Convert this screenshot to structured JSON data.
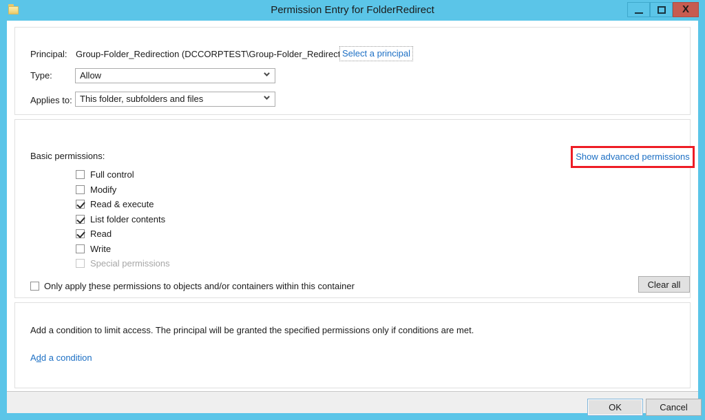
{
  "window": {
    "title": "Permission Entry for FolderRedirect",
    "icon": "folder-icon",
    "controls": {
      "minimize": "–",
      "maximize": "❑",
      "close": "X"
    }
  },
  "principal_section": {
    "principal_label": "Principal:",
    "principal_value": "Group-Folder_Redirection (DCCORPTEST\\Group-Folder_Redirection)",
    "select_principal_link": "Select a principal",
    "type_label": "Type:",
    "type_value": "Allow",
    "applies_to_label": "Applies to:",
    "applies_to_value": "This folder, subfolders and files"
  },
  "permissions_section": {
    "heading": "Basic permissions:",
    "advanced_link": "Show advanced permissions",
    "advanced_link_highlight_color": "#EE1C25",
    "items": [
      {
        "label": "Full control",
        "checked": false,
        "disabled": false
      },
      {
        "label": "Modify",
        "checked": false,
        "disabled": false
      },
      {
        "label": "Read & execute",
        "checked": true,
        "disabled": false
      },
      {
        "label": "List folder contents",
        "checked": true,
        "disabled": false
      },
      {
        "label": "Read",
        "checked": true,
        "disabled": false
      },
      {
        "label": "Write",
        "checked": false,
        "disabled": false
      },
      {
        "label": "Special permissions",
        "checked": false,
        "disabled": true
      }
    ],
    "only_apply": {
      "text_before": "Only apply ",
      "accesskey": "t",
      "text_after": "hese permissions to objects and/or containers within this container",
      "checked": false
    },
    "clear_all_button": "Clear all"
  },
  "condition_section": {
    "description": "Add a condition to limit access. The principal will be granted the specified permissions only if conditions are met.",
    "add_condition_link": {
      "text_before": "A",
      "accesskey": "d",
      "text_after": "d a condition"
    }
  },
  "footer": {
    "ok_label": "OK",
    "cancel_label": "Cancel"
  },
  "colors": {
    "titlebar": "#5BC5E8",
    "close_button": "#C75B50",
    "link": "#1C6FC4",
    "highlight": "#EE1C25"
  }
}
